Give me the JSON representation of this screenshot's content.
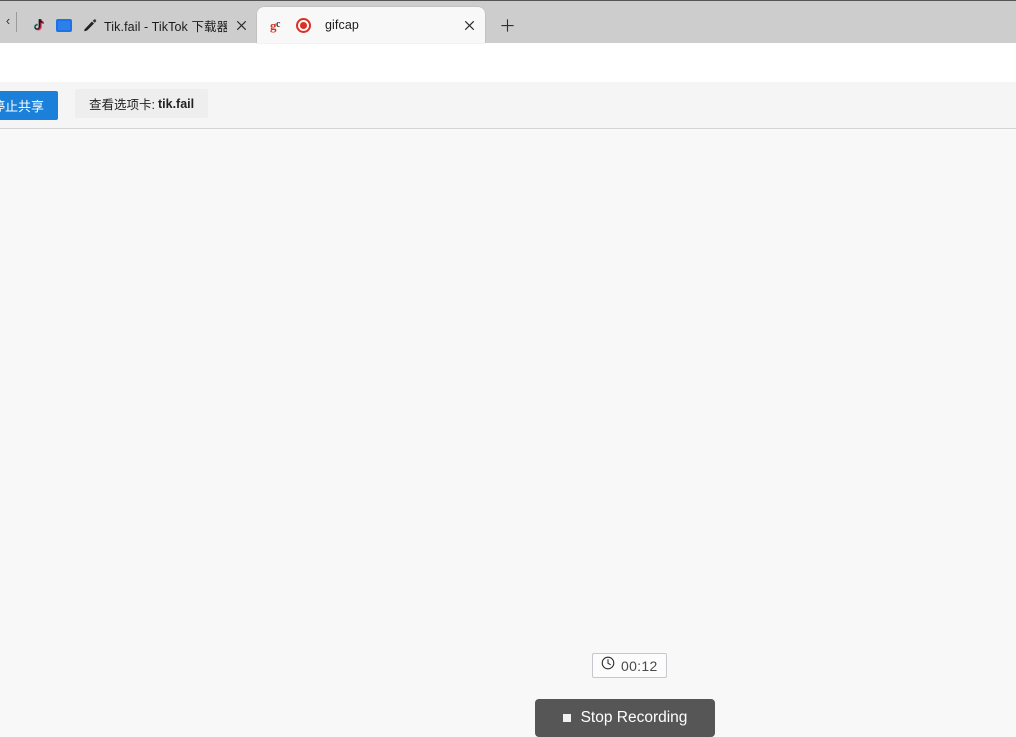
{
  "browser": {
    "tab_scroll_left_glyph": "‹",
    "new_tab_label": "+",
    "tabs": [
      {
        "title": "Tik.fail - TikTok 下载器、",
        "favicon": "tiktok-favicon",
        "secondary_icons": [
          "screen-share-icon",
          "pen-favicon"
        ],
        "active": "false",
        "close_label": "×"
      },
      {
        "title": "gifcap",
        "favicon": "gc-favicon",
        "secondary_icons": [
          "recording-dot-icon"
        ],
        "active": "true",
        "close_label": "×"
      }
    ]
  },
  "sharebar": {
    "stop_share_label": "停止共享",
    "view_tab_prefix": "查看选项卡:",
    "view_tab_target": "tik.fail"
  },
  "page": {
    "timer": "00:12",
    "stop_recording_label": "Stop Recording"
  },
  "colors": {
    "tabstrip_bg": "#cdcdcd",
    "active_tab_bg": "#f8f8f8",
    "toolbar_bg": "#ffffff",
    "sharebar_bg": "#f5f5f5",
    "page_bg": "#f8f8f8",
    "stop_share_blue": "#1a80d9",
    "view_tab_gray": "#eeeeee",
    "record_red": "#d93025",
    "stop_button_gray": "#565656",
    "timer_border": "#c5c8cc"
  }
}
